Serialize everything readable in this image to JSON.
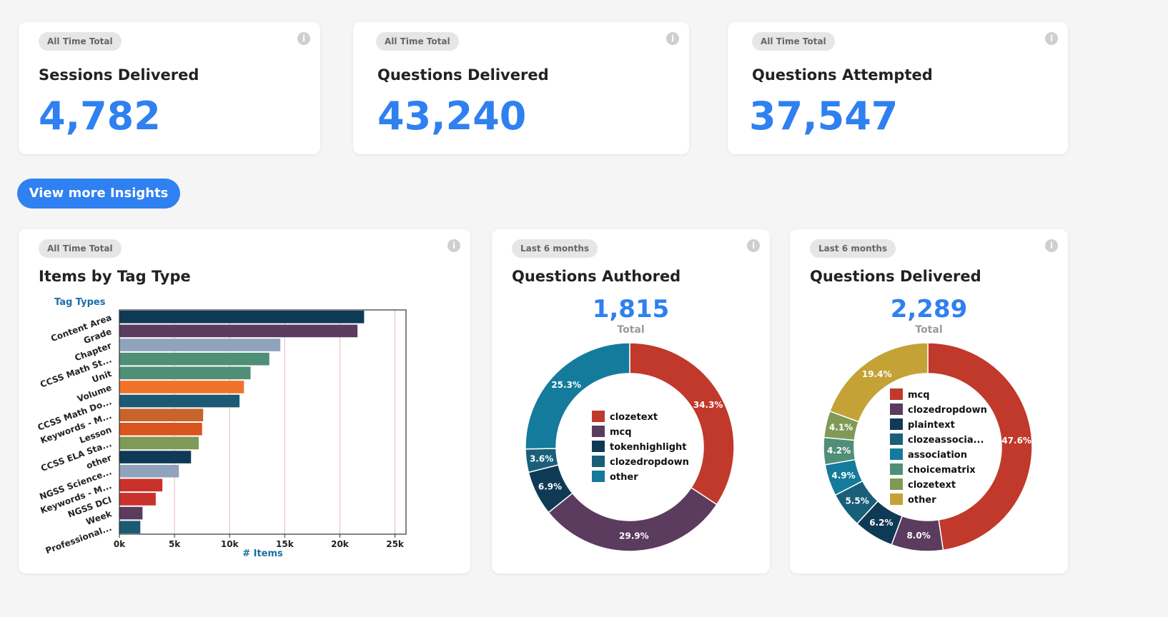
{
  "stats": [
    {
      "badge": "All Time Total",
      "title": "Sessions Delivered",
      "value": "4,782"
    },
    {
      "badge": "All Time Total",
      "title": "Questions Delivered",
      "value": "43,240"
    },
    {
      "badge": "All Time Total",
      "title": "Questions Attempted",
      "value": "37,547"
    }
  ],
  "insights_button": "View more Insights",
  "info_glyph": "i",
  "tag_card": {
    "badge": "All Time Total",
    "title": "Items by Tag Type"
  },
  "authored_card": {
    "badge": "Last 6 months",
    "title": "Questions Authored",
    "total": "1,815",
    "total_label": "Total"
  },
  "delivered_card": {
    "badge": "Last 6 months",
    "title": "Questions Delivered",
    "total": "2,289",
    "total_label": "Total"
  },
  "chart_data": [
    {
      "type": "bar",
      "orientation": "horizontal",
      "legend_title": "Tag Types",
      "xlabel": "# Items",
      "xlim": [
        0,
        26000
      ],
      "xticks": [
        "0k",
        "5k",
        "10k",
        "15k",
        "20k",
        "25k"
      ],
      "xtick_values": [
        0,
        5000,
        10000,
        15000,
        20000,
        25000
      ],
      "categories": [
        "Content Area",
        "Grade",
        "Chapter",
        "CCSS Math St...",
        "Unit",
        "Volume",
        "CCSS Math Do...",
        "Keywords - M...",
        "Lesson",
        "CCSS ELA Sta...",
        "other",
        "NGSS Science...",
        "Keywords - M...",
        "NGSS DCI",
        "Week",
        "Professional..."
      ],
      "values": [
        22200,
        21600,
        14600,
        13600,
        11900,
        11300,
        10900,
        7600,
        7500,
        7200,
        6500,
        5400,
        3900,
        3300,
        2100,
        1900
      ],
      "colors": [
        "#0f3a55",
        "#5b3b5e",
        "#8fa3bd",
        "#4f8f77",
        "#4f8f77",
        "#f0722a",
        "#1c5a73",
        "#c8642a",
        "#d9541f",
        "#7f9a57",
        "#0f3a55",
        "#8fa3bd",
        "#c8322a",
        "#c8322a",
        "#5b3b5e",
        "#1c5a73"
      ],
      "grid": true
    },
    {
      "type": "pie",
      "title": "Questions Authored",
      "labels": [
        "clozetext",
        "mcq",
        "tokenhighlight",
        "clozedropdown",
        "other"
      ],
      "values": [
        34.3,
        29.9,
        6.9,
        3.6,
        25.3
      ],
      "colors": [
        "#c0392b",
        "#5b3b5e",
        "#0f3a55",
        "#1a5f7a",
        "#147b9c"
      ],
      "legend": [
        "clozetext",
        "mcq",
        "tokenhighlight",
        "clozedropdown",
        "other"
      ]
    },
    {
      "type": "pie",
      "title": "Questions Delivered",
      "labels": [
        "mcq",
        "clozedropdown",
        "plaintext",
        "clozeassocia...",
        "association",
        "choicematrix",
        "clozetext",
        "other"
      ],
      "values": [
        47.6,
        8.0,
        6.2,
        5.5,
        4.9,
        4.2,
        4.1,
        19.4
      ],
      "colors": [
        "#c0392b",
        "#5b3b5e",
        "#0f3a55",
        "#1a5f7a",
        "#147b9c",
        "#4f8f77",
        "#7f9a57",
        "#c4a235"
      ],
      "legend": [
        "mcq",
        "clozedropdown",
        "plaintext",
        "clozeassocia...",
        "association",
        "choicematrix",
        "clozetext",
        "other"
      ]
    }
  ]
}
